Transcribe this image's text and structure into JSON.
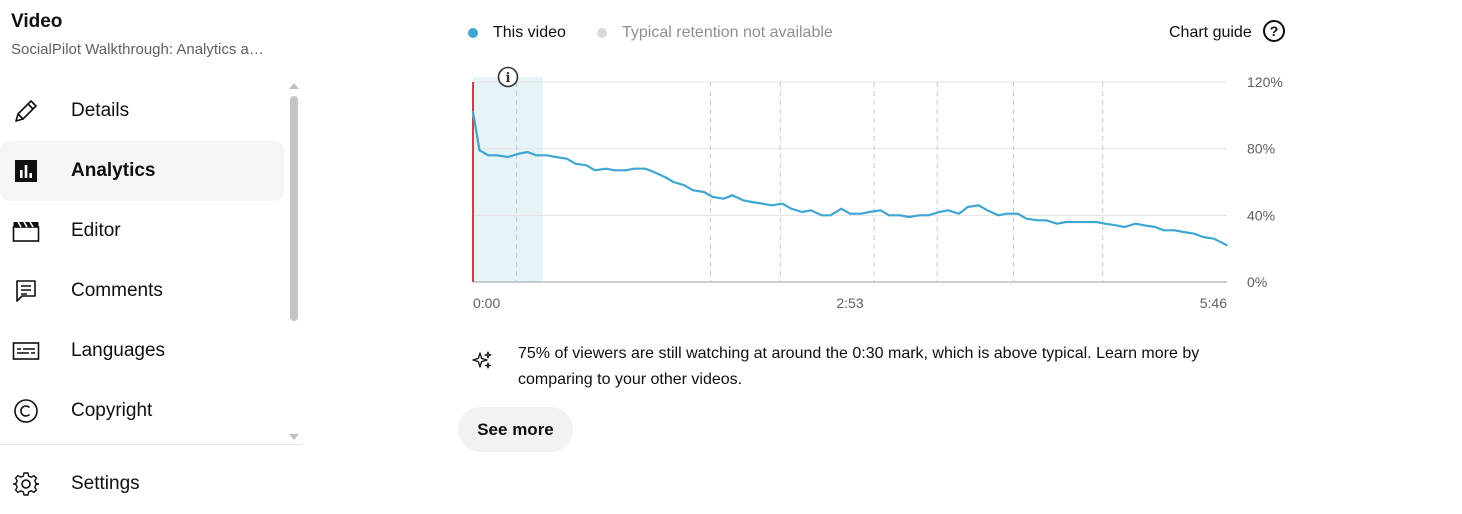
{
  "sidebar": {
    "title": "Video",
    "subtitle": "SocialPilot Walkthrough: Analytics a…",
    "items": [
      {
        "label": "Details",
        "icon": "pencil-icon"
      },
      {
        "label": "Analytics",
        "icon": "analytics-icon",
        "active": true
      },
      {
        "label": "Editor",
        "icon": "clapperboard-icon"
      },
      {
        "label": "Comments",
        "icon": "comment-icon"
      },
      {
        "label": "Languages",
        "icon": "subtitles-icon"
      },
      {
        "label": "Copyright",
        "icon": "copyright-icon"
      },
      {
        "label": "Settings",
        "icon": "gear-icon"
      }
    ]
  },
  "legend": {
    "this_video": "This video",
    "typical": "Typical retention not available",
    "this_video_color": "#3ea6d4",
    "typical_color": "#d9d9d9"
  },
  "chart_guide": {
    "label": "Chart guide",
    "icon_glyph": "?"
  },
  "chart_data": {
    "type": "line",
    "title": "",
    "xlabel": "",
    "ylabel": "",
    "x_ticks": [
      "0:00",
      "2:53",
      "5:46"
    ],
    "y_ticks": [
      "0%",
      "40%",
      "80%",
      "120%"
    ],
    "xlim": [
      0,
      346
    ],
    "ylim": [
      0,
      120
    ],
    "grid": true,
    "highlight_range_sec": [
      0,
      32
    ],
    "series": [
      {
        "name": "This video",
        "color": "#3ea6d4",
        "x": [
          0,
          3,
          7,
          11,
          16,
          21,
          25,
          29,
          34,
          38,
          43,
          47,
          52,
          56,
          61,
          65,
          70,
          74,
          79,
          83,
          88,
          92,
          97,
          101,
          106,
          110,
          115,
          119,
          124,
          128,
          133,
          137,
          142,
          146,
          151,
          155,
          160,
          164,
          169,
          173,
          178,
          182,
          187,
          191,
          196,
          200,
          205,
          209,
          214,
          218,
          223,
          227,
          232,
          236,
          241,
          245,
          250,
          254,
          259,
          263,
          268,
          272,
          277,
          281,
          286,
          290,
          295,
          299,
          304,
          308,
          313,
          317,
          322,
          326,
          331,
          335,
          340,
          346
        ],
        "y": [
          102,
          79,
          76,
          76,
          75,
          77,
          78,
          76,
          76,
          75,
          74,
          71,
          70,
          67,
          68,
          67,
          67,
          68,
          68,
          66,
          63,
          60,
          58,
          55,
          54,
          51,
          50,
          52,
          49,
          48,
          47,
          46,
          47,
          44,
          42,
          43,
          40,
          40,
          44,
          41,
          41,
          42,
          43,
          40,
          40,
          39,
          40,
          40,
          42,
          43,
          41,
          45,
          46,
          43,
          40,
          41,
          41,
          38,
          37,
          37,
          35,
          36,
          36,
          36,
          36,
          35,
          34,
          33,
          35,
          34,
          33,
          31,
          31,
          30,
          29,
          27,
          26,
          22
        ]
      }
    ],
    "vertical_marks_sec": [
      20,
      109,
      141,
      184,
      213,
      248,
      289
    ]
  },
  "info_icon_glyph": "i",
  "insight": {
    "text": "75% of viewers are still watching at around the 0:30 mark, which is above typical. Learn more by comparing to your other videos.",
    "icon": "sparkle-icon"
  },
  "see_more": "See more"
}
